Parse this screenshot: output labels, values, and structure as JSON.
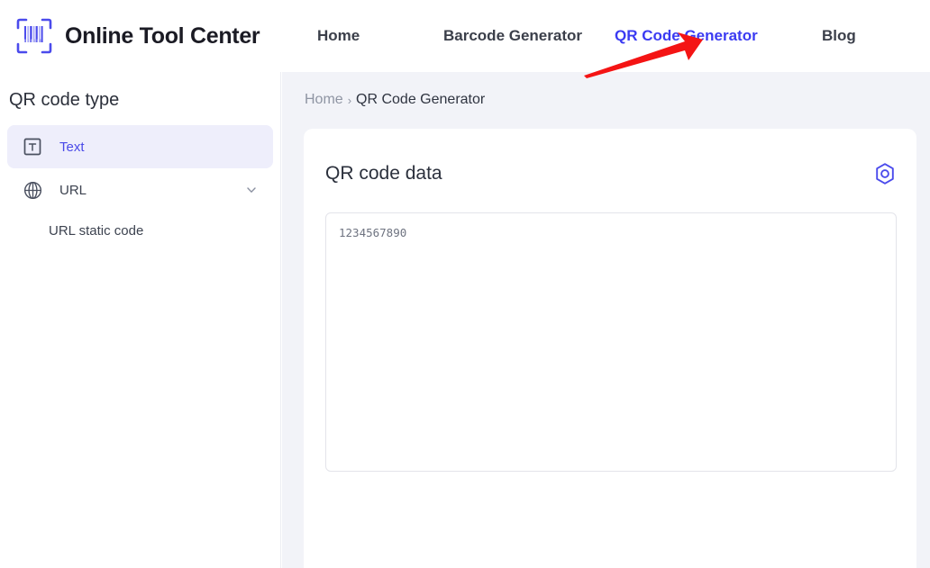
{
  "header": {
    "brand_name": "Online Tool Center",
    "logo_icon": "barcode-scan-icon",
    "nav": [
      {
        "label": "Home",
        "active": false
      },
      {
        "label": "Barcode Generator",
        "active": false
      },
      {
        "label": "QR Code Generator",
        "active": true
      },
      {
        "label": "Blog",
        "active": false
      }
    ]
  },
  "annotation": {
    "type": "arrow",
    "color": "#f41414",
    "points_to": "QR Code Generator"
  },
  "sidebar": {
    "title": "QR code type",
    "items": [
      {
        "label": "Text",
        "icon": "text-box-icon",
        "selected": true,
        "expandable": false
      },
      {
        "label": "URL",
        "icon": "globe-icon",
        "selected": false,
        "expandable": true,
        "chevron": "chevron-down-icon"
      }
    ],
    "subitems": [
      {
        "label": "URL static code",
        "parent": "URL"
      }
    ]
  },
  "breadcrumb": {
    "home": "Home",
    "separator": "›",
    "current": "QR Code Generator"
  },
  "panel": {
    "title": "QR code data",
    "action_icon": "hexagon-target-icon",
    "textarea": {
      "value": "1234567890",
      "placeholder": ""
    }
  },
  "colors": {
    "accent": "#3b3bf2",
    "brand_indigo": "#4b4bec",
    "selected_bg": "#eeeefb",
    "content_bg": "#f2f3f8",
    "annotation_red": "#f41414",
    "text_dark": "#2b303c",
    "text_muted": "#8f95a3"
  }
}
